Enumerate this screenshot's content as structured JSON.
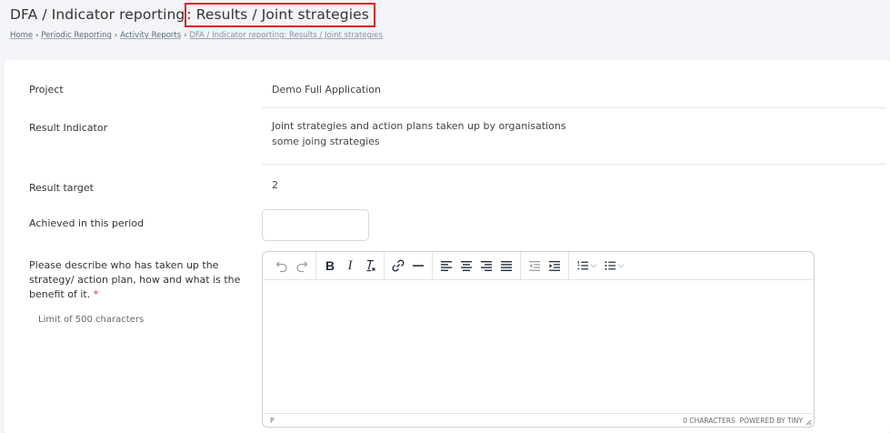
{
  "header": {
    "title_prefix": "DFA / Indicator reporting",
    "title_highlighted": ": Results / Joint strategies",
    "breadcrumb": {
      "home": "Home",
      "periodic_reporting": "Periodic Reporting",
      "activity_reports": "Activity Reports",
      "current": "DFA / Indicator reporting: Results / Joint strategies"
    }
  },
  "form": {
    "project": {
      "label": "Project",
      "value": "Demo Full Application"
    },
    "result_indicator": {
      "label": "Result Indicator",
      "value_line1": "Joint strategies and action plans taken up by organisations",
      "value_line2": "some joing strategies"
    },
    "result_target": {
      "label": "Result target",
      "value": "2"
    },
    "achieved": {
      "label": "Achieved in this period",
      "value": ""
    },
    "description": {
      "label": "Please describe who has taken up the strategy/ action plan, how and what is the benefit of it.",
      "required_mark": "*",
      "limit_text": "Limit of 500 characters"
    }
  },
  "editor": {
    "toolbar": {
      "undo_icon": "undo-icon",
      "redo_icon": "redo-icon",
      "bold_label": "B",
      "italic_label": "I",
      "clear_format_label": "I",
      "link_icon": "link-icon",
      "hr_icon": "horizontal-line-icon",
      "align_left_icon": "align-left-icon",
      "align_center_icon": "align-center-icon",
      "align_right_icon": "align-right-icon",
      "justify_icon": "justify-icon",
      "outdent_icon": "outdent-icon",
      "indent_icon": "indent-icon",
      "numbered_list_icon": "numbered-list-icon",
      "bullet_list_icon": "bullet-list-icon",
      "chevron": "⌵"
    },
    "status_path": "P",
    "char_count": "0 CHARACTERS",
    "powered_by": "POWERED BY TINY"
  },
  "colors": {
    "highlight_border": "#e0191f",
    "required": "#d9342b",
    "page_bg": "#f3f4f7"
  }
}
